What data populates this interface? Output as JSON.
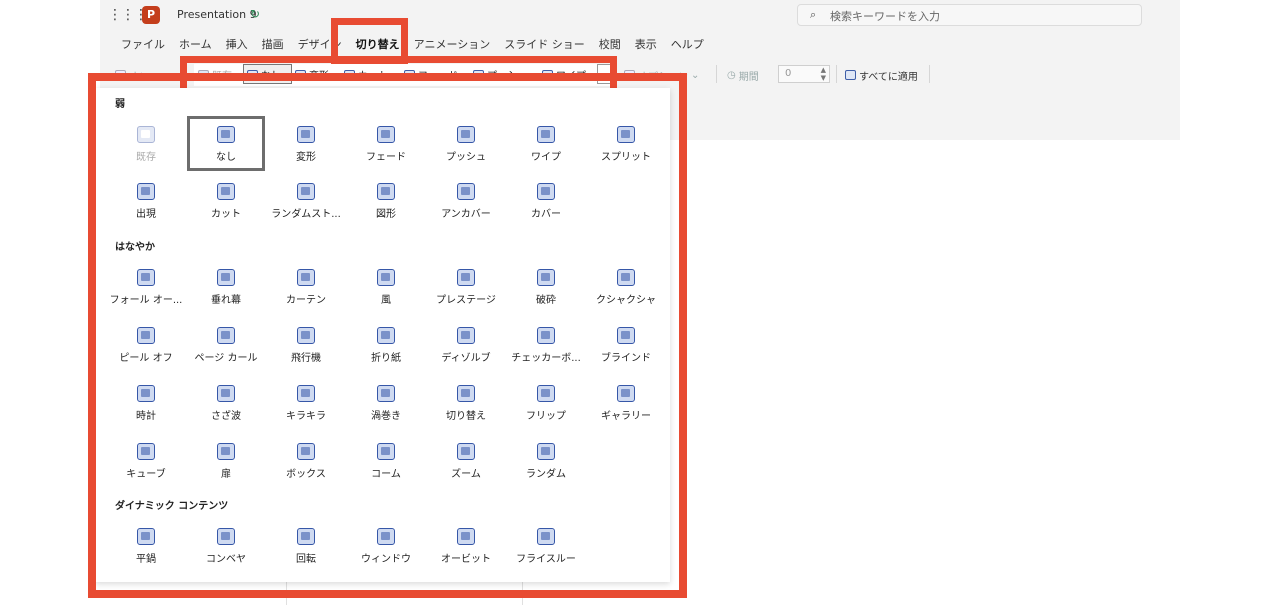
{
  "app": {
    "title": "Presentation 9",
    "logo_letter": "P",
    "search_placeholder": "検索キーワードを入力"
  },
  "menu": {
    "tabs": [
      "ファイル",
      "ホーム",
      "挿入",
      "描画",
      "デザイン",
      "切り替え",
      "アニメーション",
      "スライド ショー",
      "校閲",
      "表示",
      "ヘルプ"
    ],
    "active_tab": "切り替え"
  },
  "ribbon": {
    "existing": "既存",
    "none": "なし",
    "morph": "変形",
    "cut": "カット",
    "fade": "フェード",
    "push": "プッシュ",
    "wipe": "ワイプ",
    "options": "オプション",
    "duration_label": "期間",
    "duration_value": "0",
    "apply_all": "すべてに適用",
    "left_dim": "オン..."
  },
  "gallery": {
    "sections": [
      {
        "title": "弱",
        "items": [
          "既存",
          "なし",
          "変形",
          "フェード",
          "プッシュ",
          "ワイプ",
          "スプリット",
          "出現",
          "カット",
          "ランダムスト...",
          "図形",
          "アンカバー",
          "カバー"
        ]
      },
      {
        "title": "はなやか",
        "items": [
          "フォール オー...",
          "垂れ幕",
          "カーテン",
          "風",
          "プレステージ",
          "破砕",
          "クシャクシャ",
          "ピール オフ",
          "ページ カール",
          "飛行機",
          "折り紙",
          "ディゾルブ",
          "チェッカーボ...",
          "ブラインド",
          "時計",
          "さざ波",
          "キラキラ",
          "渦巻き",
          "切り替え",
          "フリップ",
          "ギャラリー",
          "キューブ",
          "扉",
          "ボックス",
          "コーム",
          "ズーム",
          "ランダム"
        ]
      },
      {
        "title": "ダイナミック コンテンツ",
        "items": [
          "平鍋",
          "コンベヤ",
          "回転",
          "ウィンドウ",
          "オービット",
          "フライスルー"
        ]
      }
    ],
    "selected": "なし",
    "disabled": "既存"
  },
  "colors": {
    "highlight": "#e84b32",
    "icon_blue": "#3657a8"
  }
}
